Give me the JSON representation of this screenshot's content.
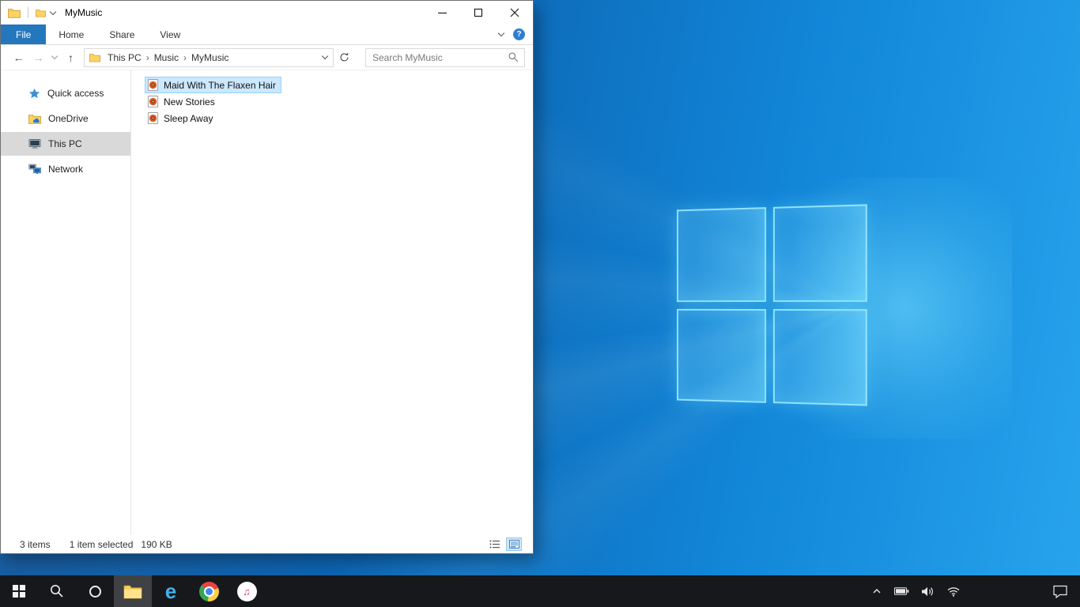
{
  "window": {
    "title": "MyMusic",
    "tabs": {
      "file": "File",
      "home": "Home",
      "share": "Share",
      "view": "View"
    },
    "breadcrumb": {
      "items": [
        "This PC",
        "Music",
        "MyMusic"
      ]
    },
    "search_placeholder": "Search MyMusic",
    "sidebar": {
      "items": [
        {
          "label": "Quick access",
          "icon": "quick-access-star-icon",
          "selected": false
        },
        {
          "label": "OneDrive",
          "icon": "onedrive-icon",
          "selected": false
        },
        {
          "label": "This PC",
          "icon": "this-pc-icon",
          "selected": true
        },
        {
          "label": "Network",
          "icon": "network-icon",
          "selected": false
        }
      ]
    },
    "files": {
      "items": [
        {
          "name": "Maid With The Flaxen Hair",
          "icon": "media-file-icon",
          "selected": true
        },
        {
          "name": "New Stories",
          "icon": "media-file-icon",
          "selected": false
        },
        {
          "name": "Sleep Away",
          "icon": "media-file-icon",
          "selected": false
        }
      ]
    },
    "status": {
      "count": "3 items",
      "selected": "1 item selected",
      "size": "190 KB"
    }
  },
  "icon_glyphs": {
    "back": "←",
    "forward": "→",
    "up": "↑",
    "crumb_sep": "›",
    "help": "?",
    "ie_logo": "e",
    "music_note": "♫"
  },
  "taskbar": {
    "buttons": [
      "start",
      "search",
      "cortana",
      "file-explorer",
      "internet-explorer",
      "chrome",
      "itunes"
    ],
    "active_button": "file-explorer",
    "tray": [
      "hidden-icons-chevron",
      "battery",
      "volume",
      "network",
      "action-center"
    ]
  },
  "colors": {
    "accent": "#0078d7",
    "file_tab_bg": "#2577bd",
    "selection_bg": "#cce8ff",
    "selection_border": "#99d1ff",
    "sidebar_selected_bg": "#d9d9d9",
    "taskbar_bg": "#17181c",
    "desktop_base": "#0f6ab8"
  }
}
